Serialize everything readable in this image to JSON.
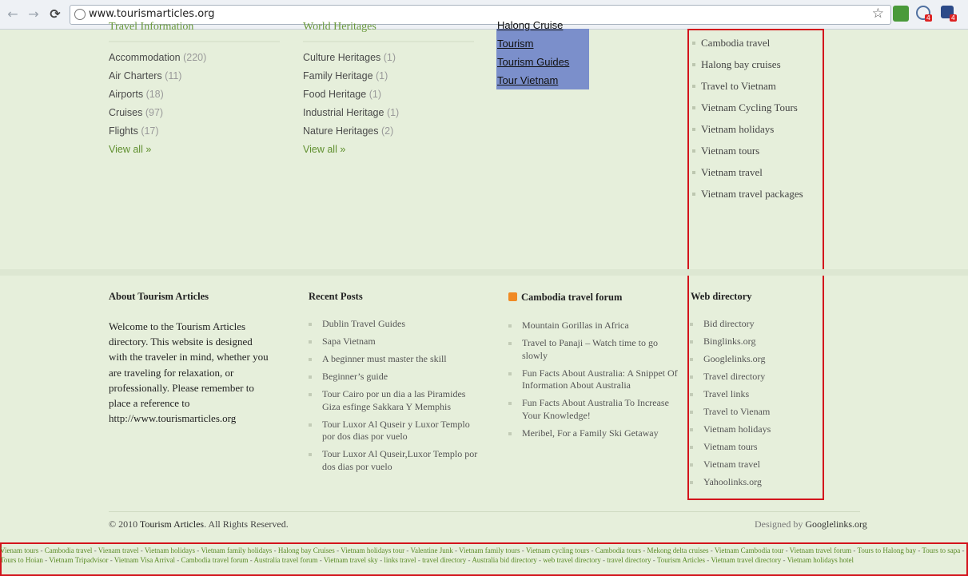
{
  "browser": {
    "back_icon": "←",
    "forward_icon": "→",
    "reload_icon": "⟳",
    "url": "www.tourismarticles.org",
    "star_icon": "☆",
    "ext_badge_1": "4",
    "ext_badge_2": "4"
  },
  "categories": [
    {
      "title": "Travel Information",
      "items": [
        {
          "label": "Accommodation",
          "count": "(220)"
        },
        {
          "label": "Air Charters",
          "count": "(11)"
        },
        {
          "label": "Airports",
          "count": "(18)"
        },
        {
          "label": "Cruises",
          "count": "(97)"
        },
        {
          "label": "Flights",
          "count": "(17)"
        }
      ],
      "view_all": "View all »"
    },
    {
      "title": "World Heritages",
      "items": [
        {
          "label": "Culture Heritages",
          "count": "(1)"
        },
        {
          "label": "Family Heritage",
          "count": "(1)"
        },
        {
          "label": "Food Heritage",
          "count": "(1)"
        },
        {
          "label": "Industrial Heritage",
          "count": "(1)"
        },
        {
          "label": "Nature Heritages",
          "count": "(2)"
        }
      ],
      "view_all": "View all »"
    }
  ],
  "tag_links": [
    "Halong Cruise",
    "Tourism",
    "Tourism Guides",
    "Tour Vietnam"
  ],
  "right_links": [
    "Cambodia travel",
    "Halong bay cruises",
    "Travel to Vietnam",
    "Vietnam Cycling Tours",
    "Vietnam holidays",
    "Vietnam tours",
    "Vietnam travel",
    "Vietnam travel packages"
  ],
  "footer": {
    "about_title": "About Tourism Articles",
    "about_text": "Welcome to the Tourism Articles directory. This website is designed with the traveler in mind, whether you are traveling for relaxation, or professionally. Please remember to place a reference to http://www.tourismarticles.org",
    "recent_title": "Recent Posts",
    "recent_posts": [
      "Dublin Travel Guides",
      "Sapa Vietnam",
      "A beginner must master the skill",
      "Beginner’s guide",
      "Tour Cairo por un dia a las Piramides Giza esfinge Sakkara Y Memphis",
      "Tour Luxor Al Quseir y Luxor Templo por dos dias por vuelo",
      "Tour Luxor Al Quseir,Luxor Templo por dos dias por vuelo"
    ],
    "forum_title": "Cambodia travel forum",
    "forum_posts": [
      "Mountain Gorillas in Africa",
      "Travel to Panaji – Watch time to go slowly",
      "Fun Facts About Australia: A Snippet Of Information About Australia",
      "Fun Facts About Australia To Increase Your Knowledge!",
      "Meribel, For a Family Ski Getaway"
    ],
    "webdir_title": "Web directory",
    "webdir_links": [
      "Bid directory",
      "Binglinks.org",
      "Googlelinks.org",
      "Travel directory",
      "Travel links",
      "Travel to Vienam",
      "Vietnam holidays",
      "Vietnam tours",
      "Vietnam travel",
      "Yahoolinks.org"
    ],
    "copyright_prefix": "© 2010",
    "copyright_site": "Tourism Articles",
    "copyright_suffix": ". All Rights Reserved.",
    "designed_by_prefix": "Designed by",
    "designed_by_link": "Googlelinks.org"
  },
  "bottom_links": [
    "Vienam tours",
    "Cambodia travel",
    "Vienam travel",
    "Vietnam holidays",
    "Vietnam family holidays",
    "Halong bay Cruises",
    "Vietnam holidays tour",
    "Valentine Junk",
    "Vietnam family tours",
    "Vietnam cycling tours",
    "Cambodia tours",
    "Mekong delta cruises",
    "Vietnam Cambodia tour",
    "Vietnam travel forum",
    "Tours to Halong bay",
    "Tours to sapa",
    "Tours to Hoian",
    "Vietnam Tripadvisor",
    "Vietnam Visa Arrival",
    "Cambodia travel forum",
    "Australia travel forum",
    "Vietnam travel sky",
    "links travel",
    "travel directory",
    "Australia bid directory",
    "web travel directory",
    "travel directory",
    "Tourism Articles",
    "Vietnam travel directory",
    "Vietnam holidays hotel"
  ],
  "colors": {
    "accent_green": "#5f8f2e",
    "highlight_blue": "#7b8fcb",
    "red_outline": "#d3141c"
  }
}
